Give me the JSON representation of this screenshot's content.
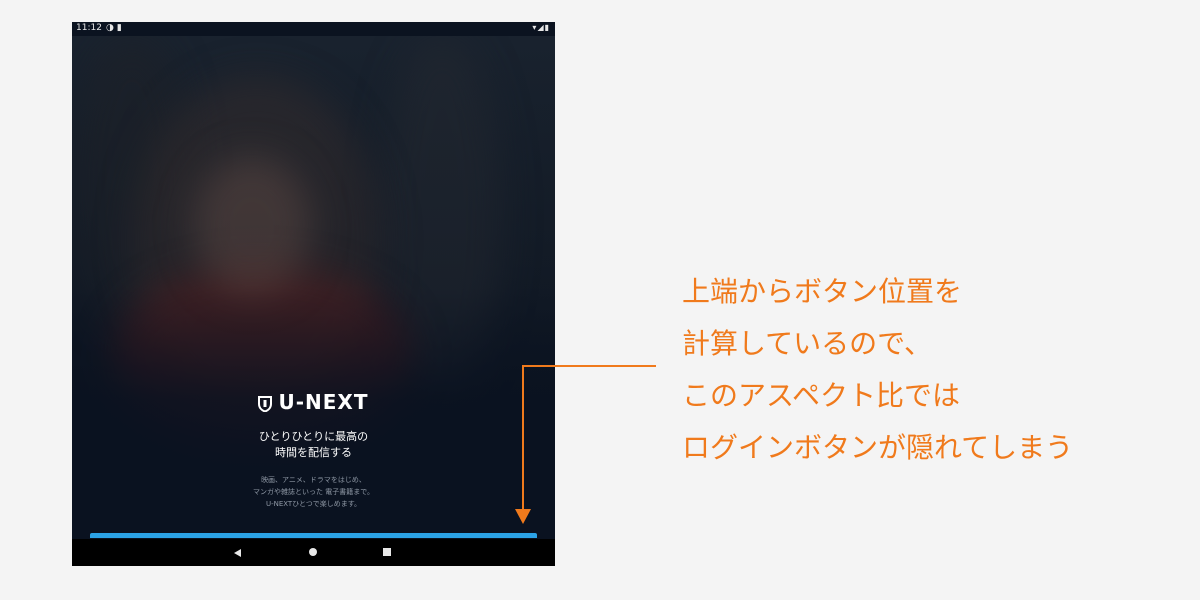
{
  "status_bar": {
    "time": "11:12",
    "left_icons": [
      "circle-half-icon",
      "sim-card-icon"
    ],
    "right_icons": [
      "wifi-icon",
      "signal-icon",
      "battery-icon"
    ]
  },
  "app": {
    "logo_text": "U-NEXT",
    "tagline": [
      "ひとりひとりに最高の",
      "時間を配信する"
    ],
    "description": [
      "映画、アニメ、ドラマをはじめ、",
      "マンガや雑誌といった 電子書籍まで。",
      "U-NEXTひとつで楽しめます。"
    ],
    "login_button_color": "#2ba2e6"
  },
  "nav_bar": {
    "buttons": [
      "back-icon",
      "home-icon",
      "recents-icon"
    ]
  },
  "annotation": {
    "color": "#f07a1c",
    "lines": [
      "上端からボタン位置を",
      "計算しているので、",
      "このアスペクト比では",
      "ログインボタンが隠れてしまう"
    ]
  }
}
